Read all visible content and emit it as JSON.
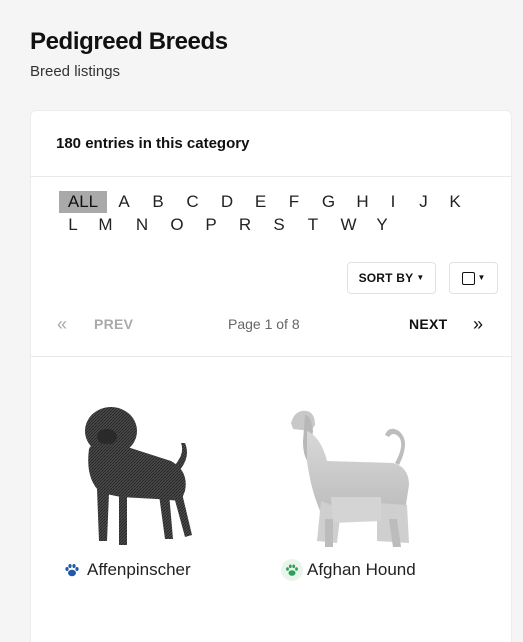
{
  "header": {
    "title": "Pedigreed Breeds",
    "subtitle": "Breed listings"
  },
  "listing": {
    "entry_count": "180 entries in this category",
    "alphabet": {
      "active": "ALL",
      "row1": [
        "ALL",
        "A",
        "B",
        "C",
        "D",
        "E",
        "F",
        "G",
        "H",
        "I",
        "J",
        "K"
      ],
      "row2": [
        "L",
        "M",
        "N",
        "O",
        "P",
        "R",
        "S",
        "T",
        "W",
        "Y"
      ]
    },
    "toolbar": {
      "sort_label": "SORT BY",
      "sort_caret_icon": "caret-down-icon",
      "view_icon": "square-icon",
      "view_caret_icon": "caret-down-icon"
    },
    "pagination": {
      "prev_icon": "double-chevron-left-icon",
      "prev_label": "PREV",
      "page_info": "Page 1 of 8",
      "next_label": "NEXT",
      "next_icon": "double-chevron-right-icon"
    },
    "breeds": [
      {
        "name": "Affenpinscher",
        "badge_icon": "paw-icon",
        "badge_color": "#1e5aa8",
        "badge_bg": "#ffffff"
      },
      {
        "name": "Afghan Hound",
        "badge_icon": "paw-icon",
        "badge_color": "#2e9e57",
        "badge_bg": "#e8f4ec"
      }
    ]
  }
}
